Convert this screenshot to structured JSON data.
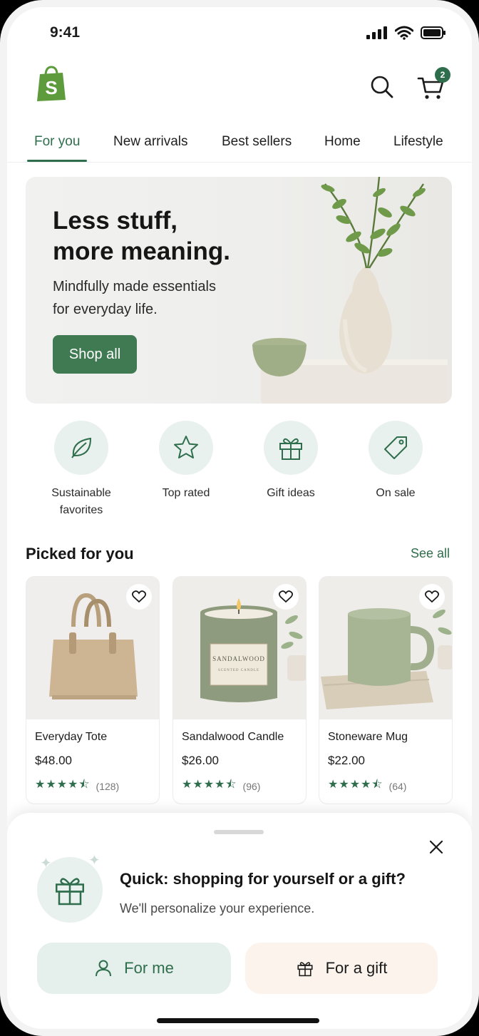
{
  "status": {
    "time": "9:41"
  },
  "header": {
    "cart_count": "2"
  },
  "tabs": [
    {
      "label": "For you",
      "active": true
    },
    {
      "label": "New arrivals"
    },
    {
      "label": "Best sellers"
    },
    {
      "label": "Home"
    },
    {
      "label": "Lifestyle"
    }
  ],
  "hero": {
    "title_line1": "Less stuff,",
    "title_line2": "more meaning.",
    "subtitle_line1": "Mindfully made essentials",
    "subtitle_line2": "for everyday life.",
    "cta": "Shop all"
  },
  "categories": [
    {
      "label_line1": "Sustainable",
      "label_line2": "favorites",
      "icon": "leaf-icon"
    },
    {
      "label_line1": "Top rated",
      "label_line2": "",
      "icon": "star-icon"
    },
    {
      "label_line1": "Gift ideas",
      "label_line2": "",
      "icon": "gift-icon"
    },
    {
      "label_line1": "On sale",
      "label_line2": "",
      "icon": "tag-icon"
    }
  ],
  "picked": {
    "title": "Picked for you",
    "see_all": "See all",
    "products": [
      {
        "name": "Everyday Tote",
        "price": "$48.00",
        "rating": 4.5,
        "reviews": "(128)"
      },
      {
        "name": "Sandalwood Candle",
        "price": "$26.00",
        "rating": 4.5,
        "reviews": "(96)"
      },
      {
        "name": "Stoneware Mug",
        "price": "$22.00",
        "rating": 4.5,
        "reviews": "(64)"
      }
    ],
    "candle_label_line1": "SANDALWOOD",
    "candle_label_line2": "SCENTED CANDLE"
  },
  "sheet": {
    "title": "Quick: shopping for yourself or a gift?",
    "subtitle": "We'll personalize your experience.",
    "option_me": "For me",
    "option_gift": "For a gift"
  },
  "colors": {
    "accent": "#2f6e4d",
    "button": "#3f7a52",
    "mint": "#e9f1ee",
    "peach": "#fbf3ec"
  }
}
